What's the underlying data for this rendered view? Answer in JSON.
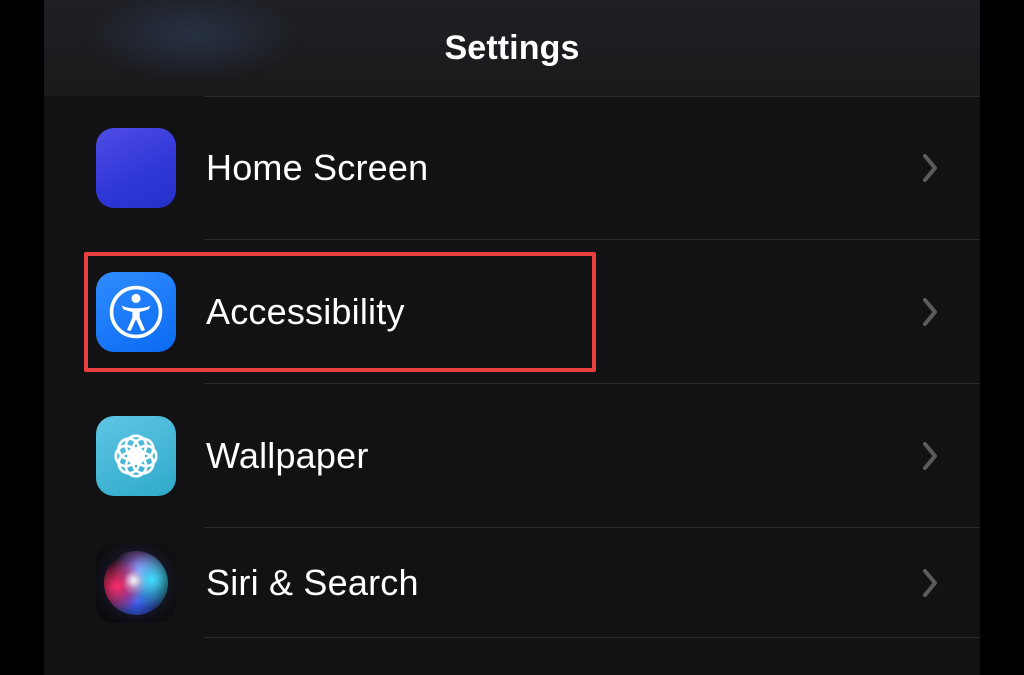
{
  "header": {
    "title": "Settings"
  },
  "rows": {
    "home": {
      "label": "Home Screen"
    },
    "accessibility": {
      "label": "Accessibility",
      "highlighted": true
    },
    "wallpaper": {
      "label": "Wallpaper"
    },
    "siri": {
      "label": "Siri & Search"
    }
  },
  "homeIconColors": [
    "#a3d36a",
    "#f04e6e",
    "#3fb1ff",
    "#b87bff",
    "#52bd79",
    "#7ad1b0",
    "#ff7a3d",
    "#ffd24a",
    "#66d0ff",
    "#ff5e9c",
    "#4bd6c3",
    "#8a8cff"
  ],
  "colors": {
    "highlight": "#e8413f"
  }
}
